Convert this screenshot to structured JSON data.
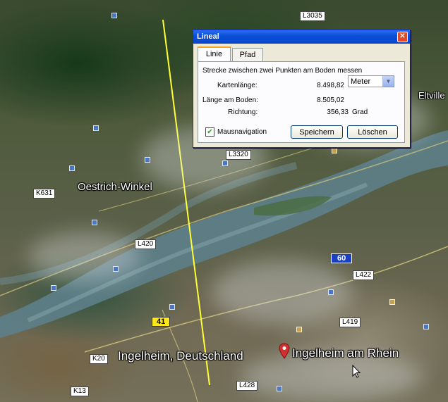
{
  "dialog": {
    "title": "Lineal",
    "tabs": [
      {
        "label": "Linie",
        "active": true
      },
      {
        "label": "Pfad",
        "active": false
      }
    ],
    "description": "Strecke zwischen zwei Punkten am Boden messen",
    "map_length_label": "Kartenlänge:",
    "map_length_value": "8.498,82",
    "unit_selected": "Meter",
    "ground_length_label": "Länge am Boden:",
    "ground_length_value": "8.505,02",
    "direction_label": "Richtung:",
    "direction_value": "356,33",
    "direction_unit": "Grad",
    "mouse_nav_label": "Mausnavigation",
    "mouse_nav_checked": true,
    "save_label": "Speichern",
    "clear_label": "Löschen"
  },
  "map": {
    "places": {
      "oestrich": "Oestrich-Winkel",
      "ingelheim_de": "Ingelheim, Deutschland",
      "ingelheim_rhein": "Ingelheim am Rhein",
      "eltville": "Eltville"
    },
    "roads": {
      "l3035": "L3035",
      "l3320": "L3320",
      "k631": "K631",
      "l420": "L420",
      "a60": "60",
      "l422": "L422",
      "b41": "41",
      "l419": "L419",
      "k20": "K20",
      "l428": "L428",
      "k13": "K13"
    },
    "ruler_color": "#ffff33"
  }
}
